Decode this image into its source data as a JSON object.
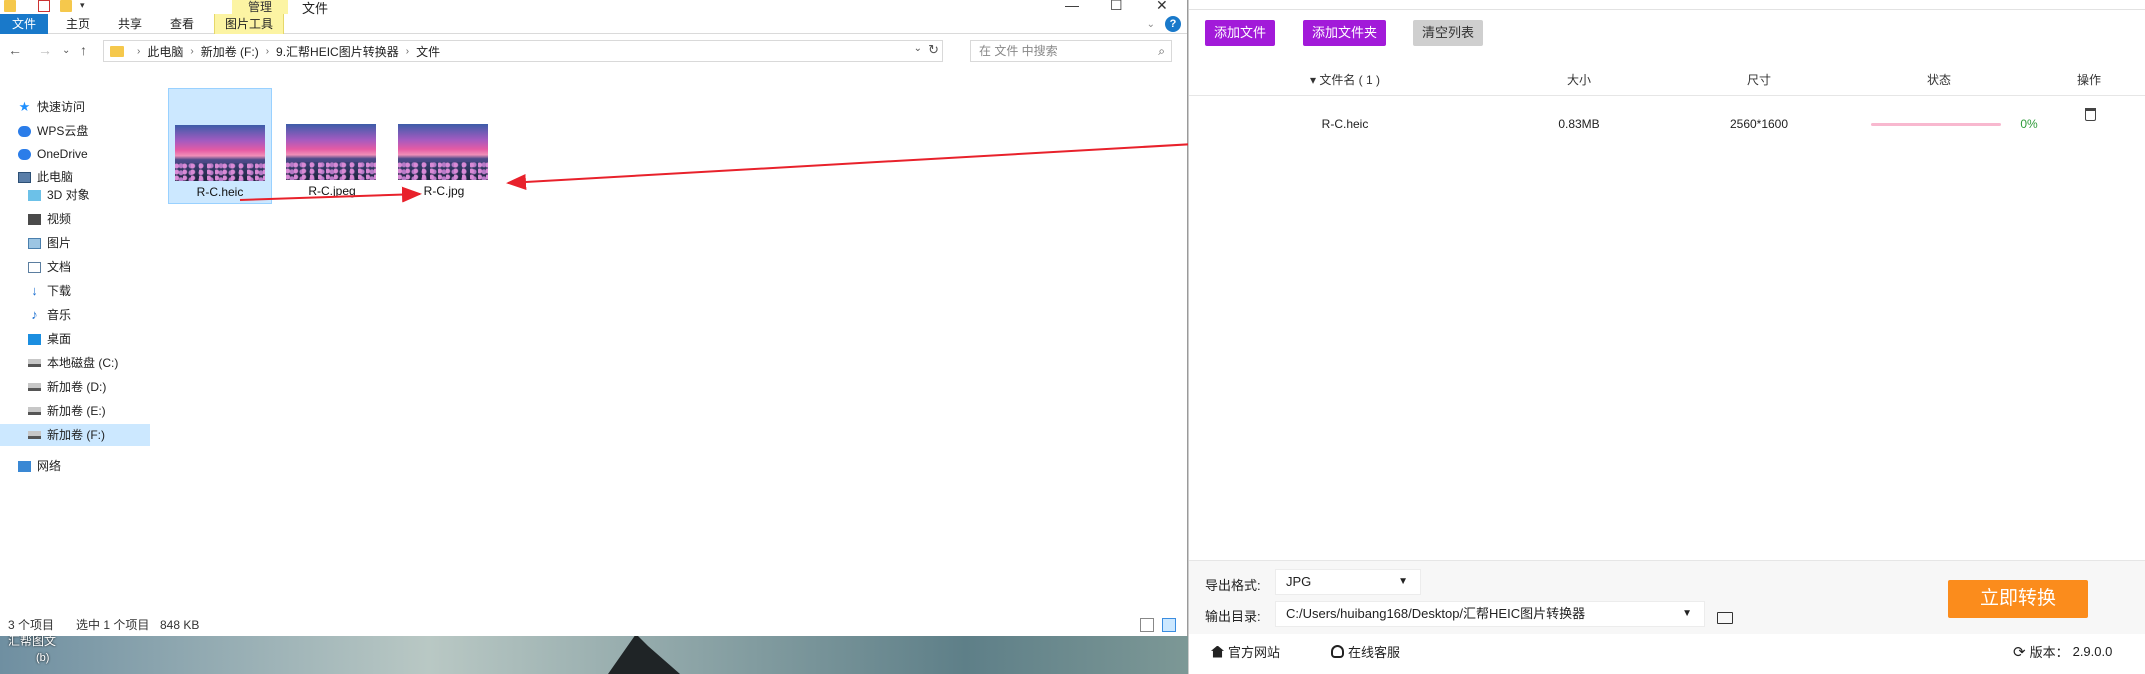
{
  "explorer": {
    "title": "文件",
    "context_tab": "管理",
    "ribbon_tabs": {
      "file": "文件",
      "home": "主页",
      "share": "共享",
      "view": "查看",
      "picture_tools": "图片工具"
    },
    "breadcrumb": [
      "此电脑",
      "新加卷 (F:)",
      "9.汇帮HEIC图片转换器",
      "文件"
    ],
    "search_placeholder": "在 文件 中搜索",
    "nav": {
      "quick_access": "快速访问",
      "wps_cloud": "WPS云盘",
      "onedrive": "OneDrive",
      "this_pc": "此电脑",
      "objects3d": "3D 对象",
      "videos": "视频",
      "pictures": "图片",
      "documents": "文档",
      "downloads": "下载",
      "music": "音乐",
      "desktop": "桌面",
      "drive_c": "本地磁盘 (C:)",
      "drive_d": "新加卷 (D:)",
      "drive_e": "新加卷 (E:)",
      "drive_f": "新加卷 (F:)",
      "network": "网络"
    },
    "files": [
      {
        "name": "R-C.heic",
        "selected": true
      },
      {
        "name": "R-C.jpeg",
        "selected": false
      },
      {
        "name": "R-C.jpg",
        "selected": false
      }
    ],
    "status": {
      "count": "3 个项目",
      "selected": "选中 1 个项目",
      "size": "848 KB"
    }
  },
  "desktop": {
    "label": "汇帮图文",
    "label2": "(b)"
  },
  "converter": {
    "buttons": {
      "add_file": "添加文件",
      "add_folder": "添加文件夹",
      "clear_list": "清空列表",
      "convert": "立即转换"
    },
    "columns": {
      "filename": "▾ 文件名 ( 1 )",
      "size": "大小",
      "dimension": "尺寸",
      "status": "状态",
      "action": "操作"
    },
    "rows": [
      {
        "filename": "R-C.heic",
        "size": "0.83MB",
        "dimension": "2560*1600",
        "progress": 0,
        "progress_text": "0%"
      }
    ],
    "export_format_label": "导出格式:",
    "export_format_value": "JPG",
    "output_dir_label": "输出目录:",
    "output_dir_value": "C:/Users/huibang168/Desktop/汇帮HEIC图片转换器",
    "footer": {
      "website": "官方网站",
      "support": "在线客服",
      "version_label": "版本：",
      "version": "2.9.0.0"
    },
    "colors": {
      "purple": "#a21ad9",
      "orange": "#fb8c1c",
      "progress": "#e23a76",
      "percent_green": "#2e9b3a"
    }
  }
}
